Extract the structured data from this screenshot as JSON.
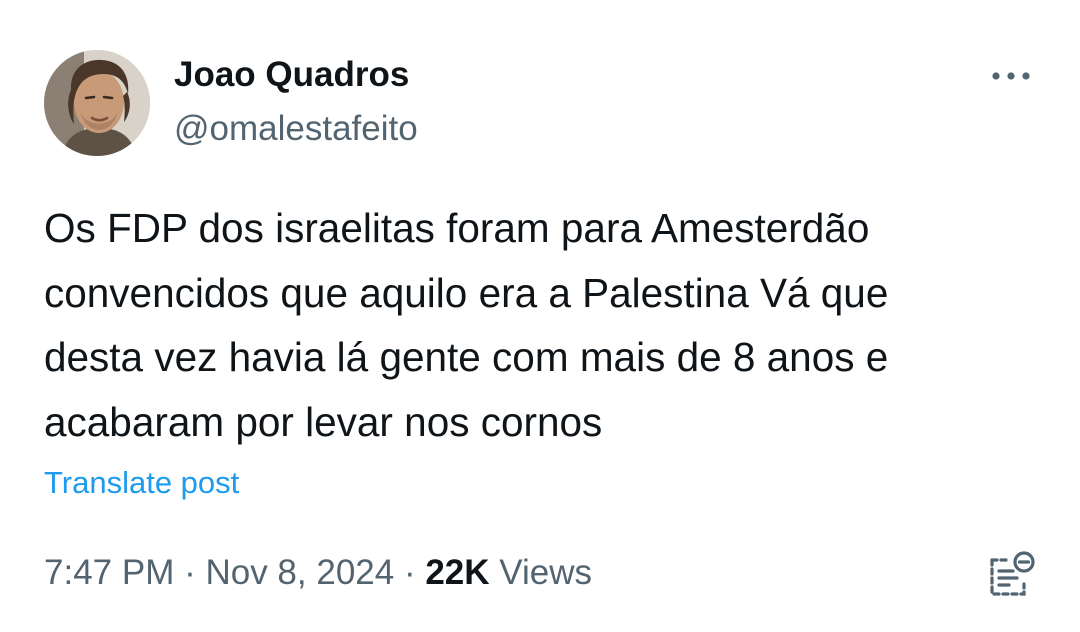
{
  "author": {
    "name": "Joao Quadros",
    "handle": "@omalestafeito",
    "avatar_icon": "profile-photo"
  },
  "post": {
    "lines": [
      "Os FDP dos israelitas foram para Amesterdão",
      "convencidos que aquilo era a Palestina Vá que",
      "desta vez havia lá gente com mais de 8 anos e",
      "acabaram por levar nos cornos"
    ],
    "translate_label": "Translate post"
  },
  "meta": {
    "time": "7:47 PM",
    "separator": " · ",
    "date": "Nov 8, 2024",
    "views_count": "22K",
    "views_label": " Views"
  },
  "icons": {
    "more": "more-horizontal-icon",
    "analytics": "post-analytics-icon"
  },
  "colors": {
    "text_primary": "#0f1419",
    "text_secondary": "#536471",
    "link": "#1d9bf0",
    "background": "#ffffff"
  }
}
